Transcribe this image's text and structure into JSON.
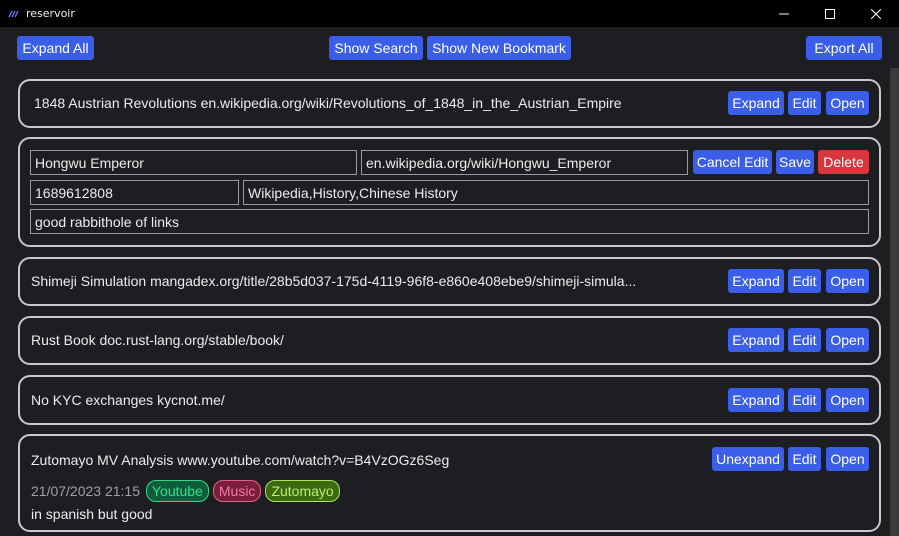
{
  "window": {
    "title": "reservoir",
    "minimize": "—",
    "maximize": "☐",
    "close": "✕"
  },
  "toolbar": {
    "expand_all": "Expand All",
    "show_search": "Show Search",
    "show_new_bookmark": "Show New Bookmark",
    "export_all": "Export All"
  },
  "bookmarks": [
    {
      "title": "1848 Austrian Revolutions",
      "url": "en.wikipedia.org/wiki/Revolutions_of_1848_in_the_Austrian_Empire",
      "expand": "Expand",
      "edit": "Edit",
      "open": "Open"
    },
    {
      "editing": true,
      "title": "Hongwu Emperor",
      "url": "en.wikipedia.org/wiki/Hongwu_Emperor",
      "timestamp": "1689612808",
      "tags": "Wikipedia,History,Chinese History",
      "note": "good rabbithole of links",
      "cancel_edit": "Cancel Edit",
      "save": "Save",
      "delete": "Delete"
    },
    {
      "title": "Shimeji Simulation",
      "url": "mangadex.org/title/28b5d037-175d-4119-96f8-e860e408ebe9/shimeji-simula...",
      "expand": "Expand",
      "edit": "Edit",
      "open": "Open"
    },
    {
      "title": "Rust Book",
      "url": "doc.rust-lang.org/stable/book/",
      "expand": "Expand",
      "edit": "Edit",
      "open": "Open"
    },
    {
      "title": "No KYC exchanges",
      "url": "kycnot.me/",
      "expand": "Expand",
      "edit": "Edit",
      "open": "Open"
    },
    {
      "title": "Zutomayo MV Analysis",
      "url": "www.youtube.com/watch?v=B4VzOGz6Seg",
      "date": "21/07/2023 21:15",
      "tags": [
        "Youtube",
        "Music",
        "Zutomayo"
      ],
      "note": "in spanish but good",
      "unexpand": "Unexpand",
      "edit": "Edit",
      "open": "Open"
    }
  ],
  "colors": {
    "button": "#3a5ee8",
    "delete": "#d9353d",
    "background": "#1d1e22",
    "tag_youtube": "#32e38a",
    "tag_music": "#e8607f",
    "tag_zutomayo": "#a8e35a"
  }
}
